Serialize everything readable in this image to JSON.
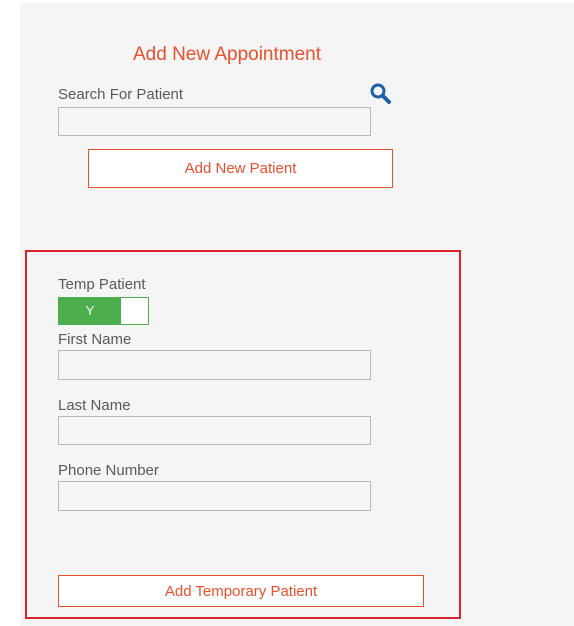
{
  "appointment": {
    "title": "Add New Appointment",
    "search_label": "Search For Patient",
    "search_value": "",
    "add_patient_button": "Add New Patient"
  },
  "temp_patient": {
    "toggle_label": "Temp Patient",
    "toggle_value": "Y",
    "toggle_on": true,
    "first_name_label": "First Name",
    "first_name_value": "",
    "last_name_label": "Last Name",
    "last_name_value": "",
    "phone_label": "Phone Number",
    "phone_value": "",
    "add_temp_button": "Add Temporary Patient"
  },
  "colors": {
    "accent": "#e8502e",
    "toggle_green": "#4cae4c",
    "highlight_border": "#d9262c",
    "search_icon": "#1f5fa8"
  },
  "icons": {
    "search": "search-icon"
  }
}
